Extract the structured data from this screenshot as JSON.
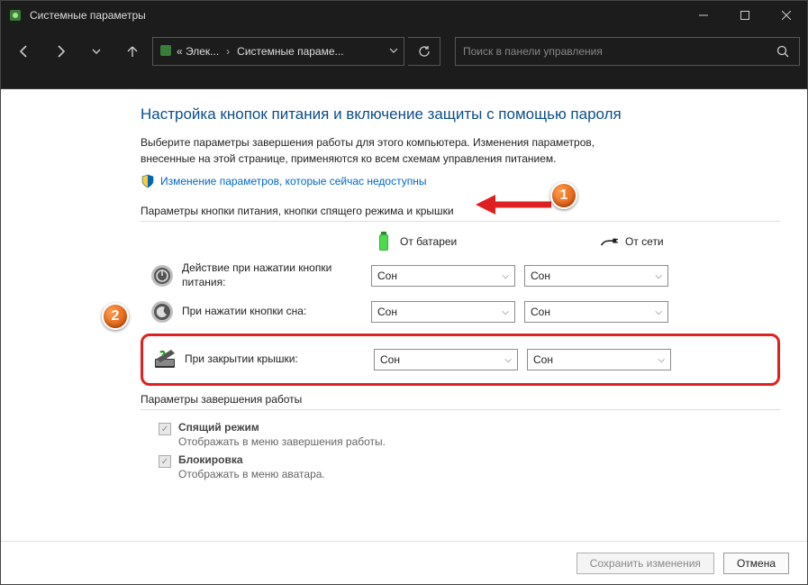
{
  "titlebar": {
    "title": "Системные параметры"
  },
  "nav": {
    "crumb1": "« Элек...",
    "crumb2": "Системные параме...",
    "search_placeholder": "Поиск в панели управления"
  },
  "page": {
    "heading": "Настройка кнопок питания и включение защиты с помощью пароля",
    "desc": "Выберите параметры завершения работы для этого компьютера. Изменения параметров, внесенные на этой странице, применяются ко всем схемам управления питанием.",
    "admin_link": "Изменение параметров, которые сейчас недоступны",
    "section1_title": "Параметры кнопки питания, кнопки спящего режима и крышки",
    "col_battery": "От батареи",
    "col_ac": "От сети",
    "rows": [
      {
        "label": "Действие при нажатии кнопки питания:",
        "battery": "Сон",
        "ac": "Сон"
      },
      {
        "label": "При нажатии кнопки сна:",
        "battery": "Сон",
        "ac": "Сон"
      },
      {
        "label": "При закрытии крышки:",
        "battery": "Сон",
        "ac": "Сон"
      }
    ],
    "section2_title": "Параметры завершения работы",
    "checks": [
      {
        "title": "Спящий режим",
        "sub": "Отображать в меню завершения работы."
      },
      {
        "title": "Блокировка",
        "sub": "Отображать в меню аватара."
      }
    ]
  },
  "footer": {
    "save": "Сохранить изменения",
    "cancel": "Отмена"
  },
  "annot": {
    "b1": "1",
    "b2": "2"
  }
}
